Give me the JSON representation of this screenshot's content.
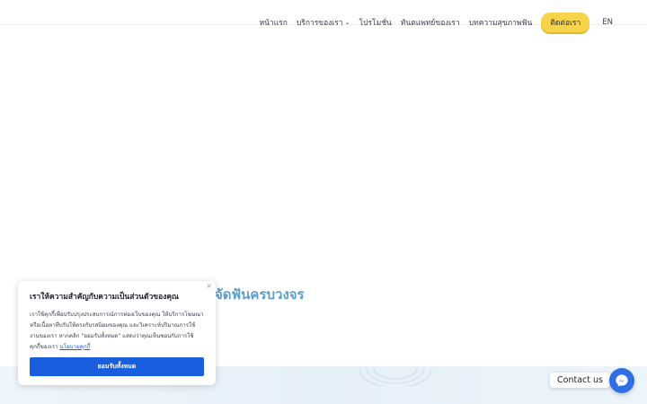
{
  "nav": {
    "items": [
      {
        "label": "หน้าแรก"
      },
      {
        "label": "บริการของเรา",
        "dropdown": true
      },
      {
        "label": "โปรโมชั่น"
      },
      {
        "label": "ทันตแพทย์ของเรา"
      },
      {
        "label": "บทความสุขภาพฟัน"
      }
    ],
    "contact_cta": "ติดต่อเรา",
    "language": "EN"
  },
  "hero": {
    "title_visible": "จัดฟันครบวงจร"
  },
  "cookie_banner": {
    "close_icon": "×",
    "title": "เราให้ความสำคัญกับความเป็นส่วนตัวของคุณ",
    "body": "เราใช้คุกกี้เพื่อปรับปรุงประสบการณ์การท่องเว็บของคุณ ให้บริการโฆษณาหรือเนื้อหาที่ปรับให้ตรงกับรสนิยมของคุณ และวิเคราะห์ปริมาณการใช้งานของเรา หากคลิก \"ยอมรับทั้งหมด\" แสดงว่าคุณเห็นชอบกับการใช้คุกกี้ของเรา",
    "policy_link": "นโยบายคุกกี้",
    "accept_all": "ยอมรับทั้งหมด"
  },
  "chat": {
    "label": "Contact us",
    "icon": "messenger-icon"
  },
  "colors": {
    "cta_yellow": "#f6d34a",
    "hero_blue": "#5b9ec9",
    "accept_blue": "#1a5ee0",
    "messenger_blue": "#2f6fe3",
    "band_bg": "#e6f0f9"
  }
}
